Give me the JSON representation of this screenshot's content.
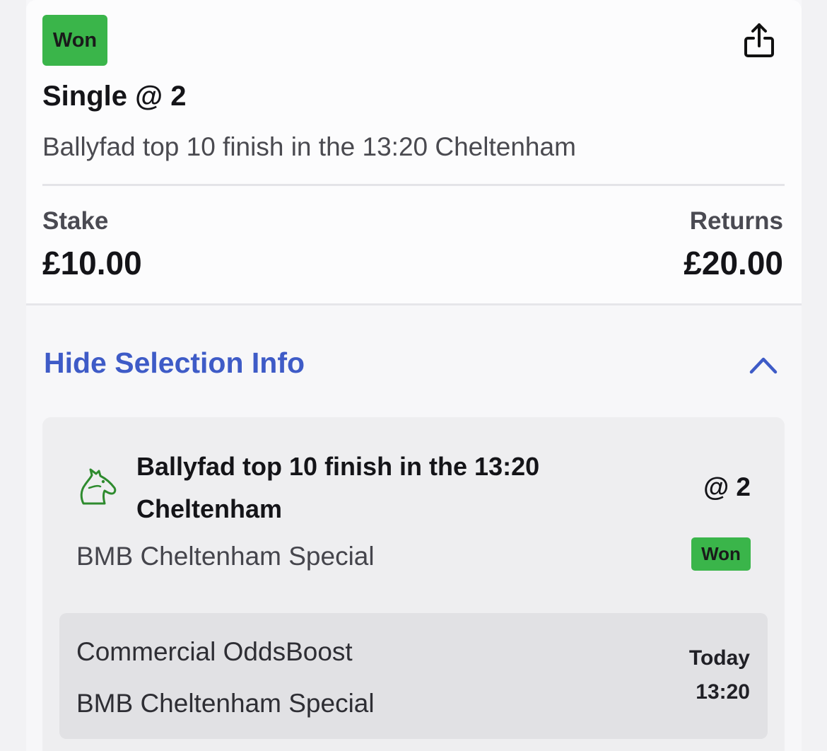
{
  "bet": {
    "status": "Won",
    "title": "Single @ 2",
    "description": "Ballyfad top 10 finish in the 13:20 Cheltenham",
    "stake_label": "Stake",
    "stake_value": "£10.00",
    "returns_label": "Returns",
    "returns_value": "£20.00"
  },
  "toggle": {
    "label": "Hide Selection Info"
  },
  "selection": {
    "name": "Ballyfad top 10 finish in the 13:20 Cheltenham",
    "odds": "@ 2",
    "market": "BMB Cheltenham Special",
    "status": "Won",
    "event": {
      "line1": "Commercial OddsBoost",
      "line2": "BMB Cheltenham Special",
      "day": "Today",
      "time": "13:20"
    }
  },
  "colors": {
    "won": "#3ab54a",
    "link": "#3e5bc7",
    "horse_icon": "#2e8b2e"
  },
  "icons": {
    "share": "share-icon",
    "chevron": "chevron-up-icon",
    "sport": "horse-racing-icon"
  }
}
